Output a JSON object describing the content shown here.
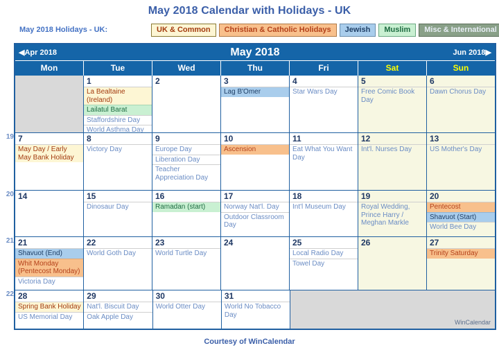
{
  "page": {
    "title": "May 2018 Calendar with Holidays - UK",
    "footer": "Courtesy of WinCalendar",
    "watermark": "WinCalendar",
    "accent_blue": "#1565a8",
    "title_color": "#3a5ea8"
  },
  "legend": {
    "heading": "May 2018 Holidays - UK:",
    "chips": [
      {
        "label": "UK & Common",
        "key": "uk",
        "bg": "#fdf6d4",
        "fg": "#a33b0f"
      },
      {
        "label": "Christian & Catholic Holidays",
        "key": "christian",
        "bg": "#f8c08c",
        "fg": "#b4411a"
      },
      {
        "label": "Jewish",
        "key": "jewish",
        "bg": "#a9cdec",
        "fg": "#1f3f66"
      },
      {
        "label": "Muslim",
        "key": "muslim",
        "bg": "#c9f0d2",
        "fg": "#1d6b41"
      },
      {
        "label": "Misc & International",
        "key": "misc",
        "bg": "#89a088",
        "fg": "#e8eef6"
      }
    ]
  },
  "nav": {
    "prev": "◀Apr 2018",
    "next": "Jun 2018▶",
    "month_title": "May 2018"
  },
  "weekdays": [
    {
      "label": "Mon",
      "weekend": false
    },
    {
      "label": "Tue",
      "weekend": false
    },
    {
      "label": "Wed",
      "weekend": false
    },
    {
      "label": "Thu",
      "weekend": false
    },
    {
      "label": "Fri",
      "weekend": false
    },
    {
      "label": "Sat",
      "weekend": true
    },
    {
      "label": "Sun",
      "weekend": true
    }
  ],
  "weeks": [
    {
      "week_number": "",
      "days": [
        {
          "num": "",
          "blank": true,
          "weekend": false,
          "events": []
        },
        {
          "num": "1",
          "weekend": false,
          "events": [
            {
              "text": "La Bealtaine (Ireland)",
              "cat": "uk"
            },
            {
              "text": "Lailatul Barat",
              "cat": "muslim"
            },
            {
              "text": "Staffordshire Day",
              "cat": "misc"
            },
            {
              "text": "World Asthma Day",
              "cat": "misc"
            }
          ]
        },
        {
          "num": "2",
          "weekend": false,
          "events": []
        },
        {
          "num": "3",
          "weekend": false,
          "events": [
            {
              "text": "Lag B'Omer",
              "cat": "jewish"
            }
          ]
        },
        {
          "num": "4",
          "weekend": false,
          "events": [
            {
              "text": "Star Wars Day",
              "cat": "misc"
            }
          ]
        },
        {
          "num": "5",
          "weekend": true,
          "events": [
            {
              "text": "Free Comic Book Day",
              "cat": "misc"
            }
          ]
        },
        {
          "num": "6",
          "weekend": true,
          "events": [
            {
              "text": "Dawn Chorus Day",
              "cat": "misc"
            }
          ]
        }
      ]
    },
    {
      "week_number": "19",
      "days": [
        {
          "num": "7",
          "weekend": false,
          "events": [
            {
              "text": "May Day / Early May Bank Holiday",
              "cat": "uk"
            }
          ]
        },
        {
          "num": "8",
          "weekend": false,
          "events": [
            {
              "text": "Victory Day",
              "cat": "misc"
            }
          ]
        },
        {
          "num": "9",
          "weekend": false,
          "events": [
            {
              "text": "Europe Day",
              "cat": "misc"
            },
            {
              "text": "Liberation Day",
              "cat": "misc"
            },
            {
              "text": "Teacher Appreciation Day",
              "cat": "misc"
            }
          ]
        },
        {
          "num": "10",
          "weekend": false,
          "events": [
            {
              "text": "Ascension",
              "cat": "christian"
            }
          ]
        },
        {
          "num": "11",
          "weekend": false,
          "events": [
            {
              "text": "Eat What You Want Day",
              "cat": "misc"
            }
          ]
        },
        {
          "num": "12",
          "weekend": true,
          "events": [
            {
              "text": "Int'l. Nurses Day",
              "cat": "misc"
            }
          ]
        },
        {
          "num": "13",
          "weekend": true,
          "events": [
            {
              "text": "US Mother's Day",
              "cat": "misc"
            }
          ]
        }
      ]
    },
    {
      "week_number": "20",
      "days": [
        {
          "num": "14",
          "weekend": false,
          "events": []
        },
        {
          "num": "15",
          "weekend": false,
          "events": [
            {
              "text": "Dinosaur Day",
              "cat": "misc"
            }
          ]
        },
        {
          "num": "16",
          "weekend": false,
          "events": [
            {
              "text": "Ramadan (start)",
              "cat": "muslim"
            }
          ]
        },
        {
          "num": "17",
          "weekend": false,
          "events": [
            {
              "text": "Norway Nat'l. Day",
              "cat": "misc"
            },
            {
              "text": "Outdoor Classroom Day",
              "cat": "misc"
            }
          ]
        },
        {
          "num": "18",
          "weekend": false,
          "events": [
            {
              "text": "Int'l Museum Day",
              "cat": "misc"
            }
          ]
        },
        {
          "num": "19",
          "weekend": true,
          "events": [
            {
              "text": "Royal Wedding, Prince Harry / Meghan Markle",
              "cat": "misc"
            }
          ]
        },
        {
          "num": "20",
          "weekend": true,
          "events": [
            {
              "text": "Pentecost",
              "cat": "christian"
            },
            {
              "text": "Shavuot (Start)",
              "cat": "jewish"
            },
            {
              "text": "World Bee Day",
              "cat": "misc"
            }
          ]
        }
      ]
    },
    {
      "week_number": "21",
      "days": [
        {
          "num": "21",
          "weekend": false,
          "events": [
            {
              "text": "Shavuot (End)",
              "cat": "jewish"
            },
            {
              "text": "Whit Monday (Pentecost Monday)",
              "cat": "christian"
            },
            {
              "text": "Victoria Day",
              "cat": "misc"
            }
          ]
        },
        {
          "num": "22",
          "weekend": false,
          "events": [
            {
              "text": "World Goth Day",
              "cat": "misc"
            }
          ]
        },
        {
          "num": "23",
          "weekend": false,
          "events": [
            {
              "text": "World Turtle Day",
              "cat": "misc"
            }
          ]
        },
        {
          "num": "24",
          "weekend": false,
          "events": []
        },
        {
          "num": "25",
          "weekend": false,
          "events": [
            {
              "text": "Local Radio Day",
              "cat": "misc"
            },
            {
              "text": "Towel Day",
              "cat": "misc"
            }
          ]
        },
        {
          "num": "26",
          "weekend": true,
          "events": []
        },
        {
          "num": "27",
          "weekend": true,
          "events": [
            {
              "text": "Trinity Saturday",
              "cat": "christian"
            }
          ]
        }
      ]
    },
    {
      "week_number": "22",
      "days": [
        {
          "num": "28",
          "weekend": false,
          "events": [
            {
              "text": "Spring Bank Holiday",
              "cat": "uk"
            },
            {
              "text": "US Memorial Day",
              "cat": "misc"
            }
          ]
        },
        {
          "num": "29",
          "weekend": false,
          "events": [
            {
              "text": "Nat'l. Biscuit Day",
              "cat": "misc"
            },
            {
              "text": "Oak Apple Day",
              "cat": "misc"
            }
          ]
        },
        {
          "num": "30",
          "weekend": false,
          "events": [
            {
              "text": "World Otter Day",
              "cat": "misc"
            }
          ]
        },
        {
          "num": "31",
          "weekend": false,
          "events": [
            {
              "text": "World No Tobacco Day",
              "cat": "misc"
            }
          ]
        },
        {
          "num": "",
          "tail": true,
          "weekend": false,
          "events": []
        },
        {
          "num": "",
          "tail": true,
          "weekend": false,
          "events": []
        },
        {
          "num": "",
          "tail": true,
          "weekend": false,
          "events": []
        }
      ]
    }
  ]
}
